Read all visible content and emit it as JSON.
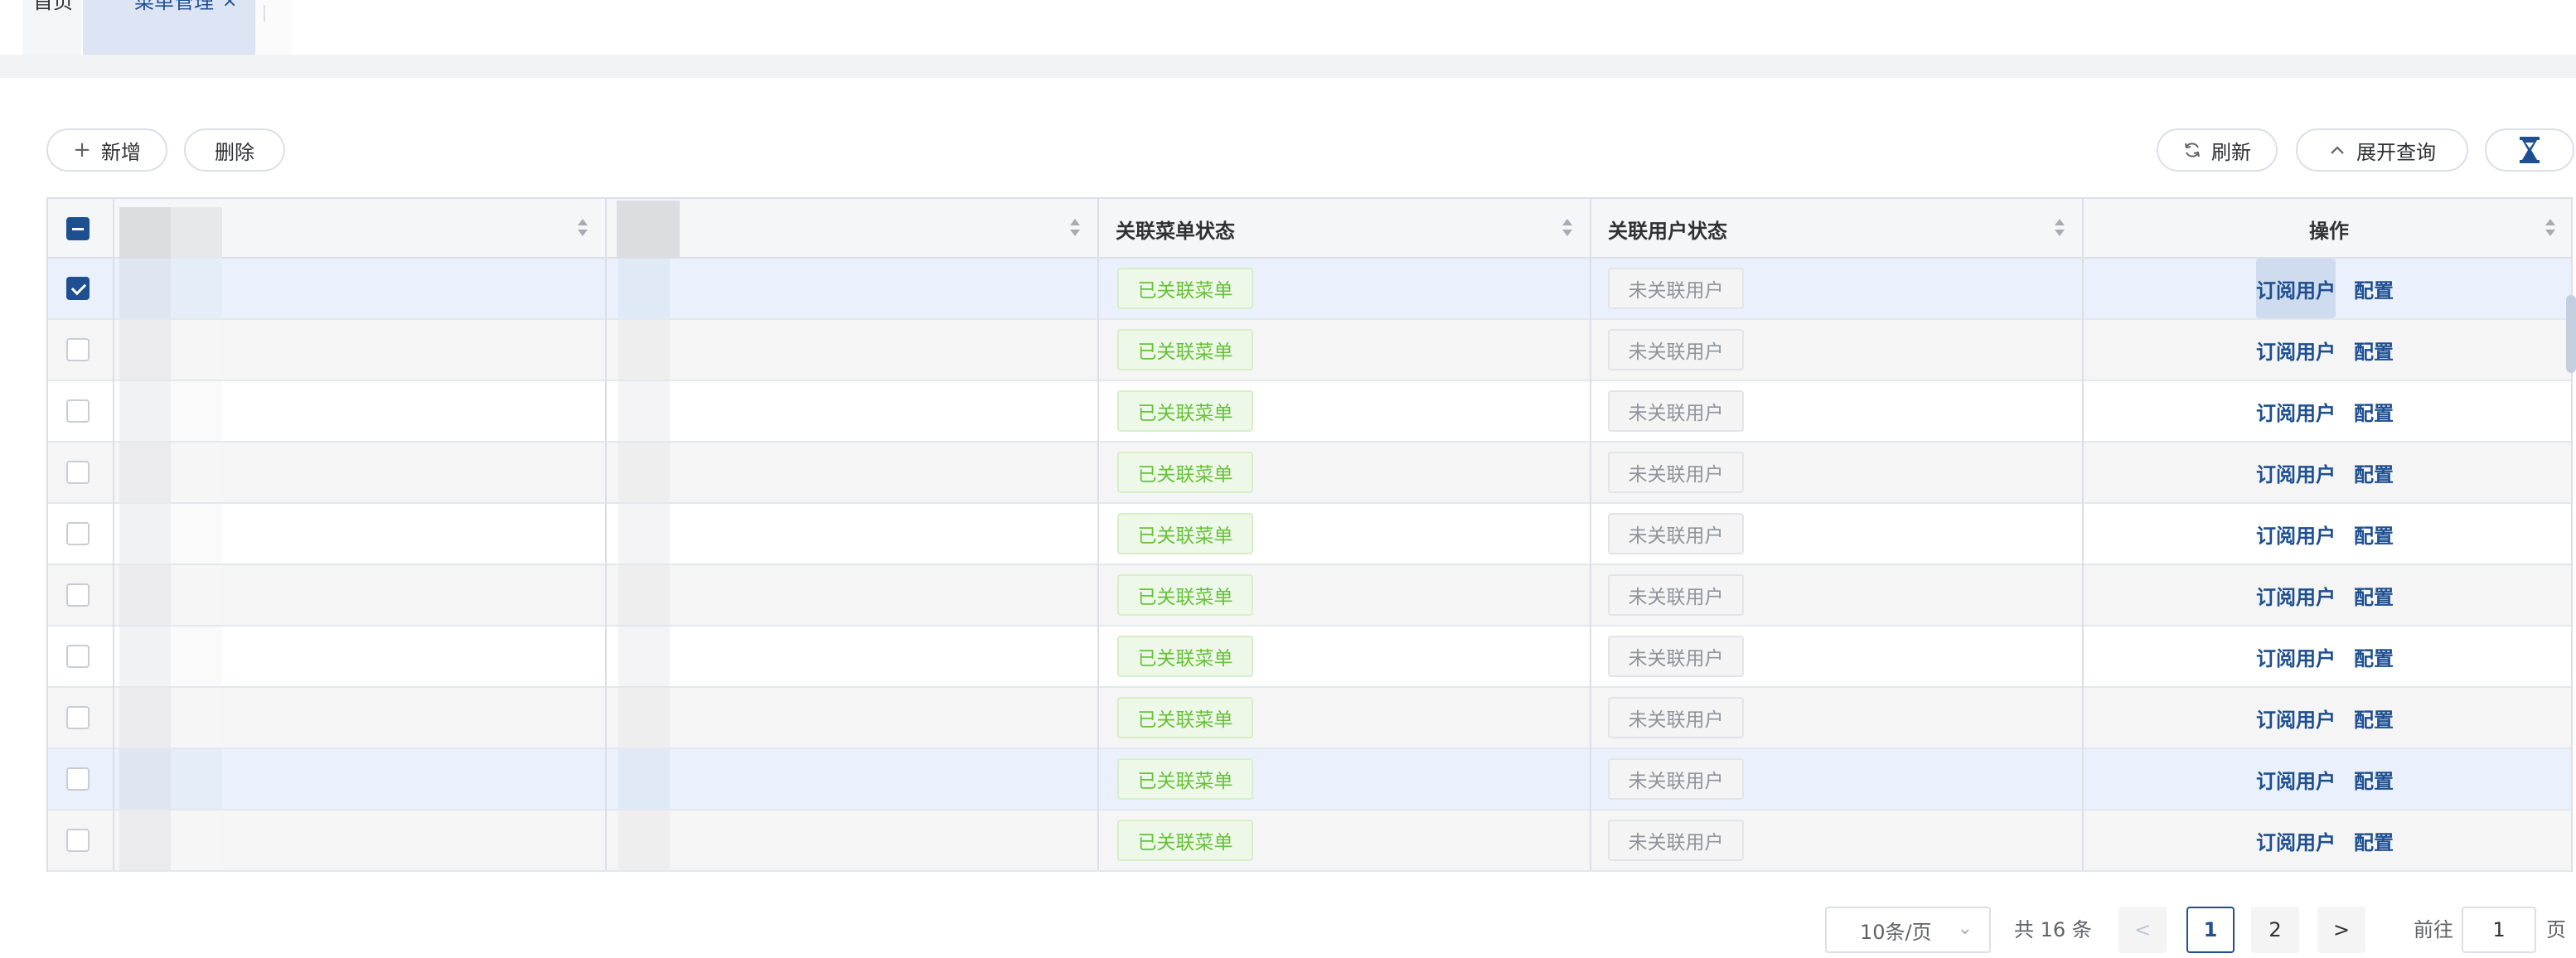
{
  "tabs": {
    "home_label": "首页",
    "menu_label": "菜单管理",
    "menu_close": "×"
  },
  "toolbar": {
    "add_icon": "+",
    "add_label": "新增",
    "delete_label": "删除",
    "refresh_icon": "refresh-icon",
    "refresh_label": "刷新",
    "expand_icon": "chevron-up-icon",
    "expand_label": "展开查询",
    "filter_icon": "hourglass-icon"
  },
  "table": {
    "headers": {
      "col1": "",
      "col2": "",
      "menu_status": "关联菜单状态",
      "user_status": "关联用户状态",
      "operations": "操作"
    },
    "rows": [
      {
        "menu_status": "已关联菜单",
        "user_status": "未关联用户",
        "subscribe": "订阅用户",
        "config": "配置",
        "checked": true
      },
      {
        "menu_status": "已关联菜单",
        "user_status": "未关联用户",
        "subscribe": "订阅用户",
        "config": "配置",
        "checked": false
      },
      {
        "menu_status": "已关联菜单",
        "user_status": "未关联用户",
        "subscribe": "订阅用户",
        "config": "配置",
        "checked": false
      },
      {
        "menu_status": "已关联菜单",
        "user_status": "未关联用户",
        "subscribe": "订阅用户",
        "config": "配置",
        "checked": false
      },
      {
        "menu_status": "已关联菜单",
        "user_status": "未关联用户",
        "subscribe": "订阅用户",
        "config": "配置",
        "checked": false
      },
      {
        "menu_status": "已关联菜单",
        "user_status": "未关联用户",
        "subscribe": "订阅用户",
        "config": "配置",
        "checked": false
      },
      {
        "menu_status": "已关联菜单",
        "user_status": "未关联用户",
        "subscribe": "订阅用户",
        "config": "配置",
        "checked": false
      },
      {
        "menu_status": "已关联菜单",
        "user_status": "未关联用户",
        "subscribe": "订阅用户",
        "config": "配置",
        "checked": false
      },
      {
        "menu_status": "已关联菜单",
        "user_status": "未关联用户",
        "subscribe": "订阅用户",
        "config": "配置",
        "checked": false
      },
      {
        "menu_status": "已关联菜单",
        "user_status": "未关联用户",
        "subscribe": "订阅用户",
        "config": "配置",
        "checked": false
      }
    ]
  },
  "pagination": {
    "page_size": "10条/页",
    "total": "共 16 条",
    "prev": "<",
    "pages": [
      "1",
      "2"
    ],
    "current": "1",
    "next": ">",
    "goto_label": "前往",
    "goto_value": "1",
    "page_unit": "页"
  },
  "colors": {
    "primary": "#1d4f91",
    "success": "#67c23a",
    "info": "#909399",
    "highlight_row": "#eaf1fc"
  }
}
